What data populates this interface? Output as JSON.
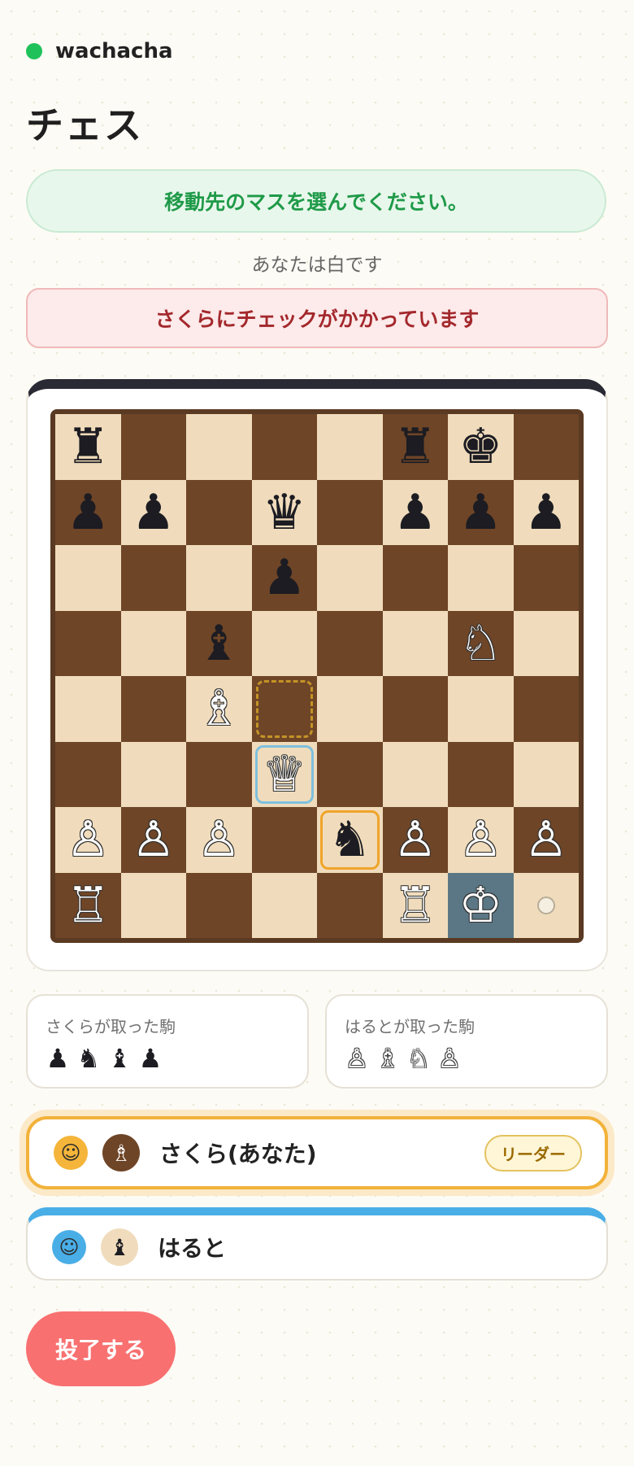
{
  "app": {
    "name": "wachacha",
    "status_color": "#1fc25a"
  },
  "page_title": "チェス",
  "status_message": "移動先のマスを選んでください。",
  "role_text": "あなたは白です",
  "check_message": "さくらにチェックがかかっています",
  "board": {
    "light_color": "#f0dcbc",
    "dark_color": "#6e4527",
    "ranks": [
      [
        "bR",
        "",
        "",
        "",
        "",
        "bR",
        "bK",
        ""
      ],
      [
        "bP",
        "bP",
        "",
        "bQ",
        "",
        "bP",
        "bP",
        "bP"
      ],
      [
        "",
        "",
        "",
        "bP",
        "",
        "",
        "",
        ""
      ],
      [
        "",
        "",
        "bB",
        "",
        "",
        "",
        "wN",
        ""
      ],
      [
        "",
        "",
        "wB",
        "",
        "",
        "",
        "",
        ""
      ],
      [
        "",
        "",
        "",
        "wQ",
        "",
        "",
        "",
        ""
      ],
      [
        "wP",
        "wP",
        "wP",
        "",
        "bN",
        "wP",
        "wP",
        "wP"
      ],
      [
        "wR",
        "",
        "",
        "",
        "",
        "wR",
        "wK",
        ""
      ]
    ],
    "highlights": {
      "selected": "e2",
      "move_target": "d4",
      "last_move": "d3",
      "in_check": "g1",
      "move_hint": "h1"
    }
  },
  "captured": {
    "sakura": {
      "label": "さくらが取った駒",
      "pieces": [
        "♟",
        "♞",
        "♝",
        "♟"
      ]
    },
    "haruto": {
      "label": "はるとが取った駒",
      "pieces": [
        "♙",
        "♗",
        "♘",
        "♙"
      ]
    }
  },
  "players": [
    {
      "name": "さくら(あなた)",
      "avatar_icon": "girl-face-icon",
      "piece_icon": "♗",
      "badge": "リーダー"
    },
    {
      "name": "はると",
      "avatar_icon": "boy-face-icon",
      "piece_icon": "♝"
    }
  ],
  "resign_label": "投了する"
}
